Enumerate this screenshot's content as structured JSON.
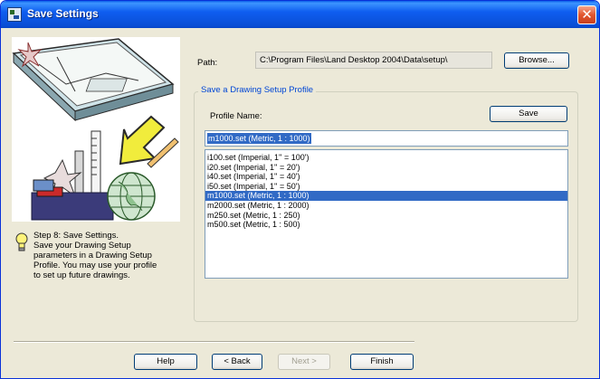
{
  "window": {
    "title": "Save Settings",
    "close_glyph": "✕"
  },
  "left": {
    "illustration_icon": "setup-wizard-illustration",
    "tip_icon": "lightbulb-icon",
    "step_lines": [
      "Step 8:  Save Settings.",
      "Save your Drawing Setup",
      "parameters in a Drawing Setup",
      "Profile.  You may use your profile",
      "to set up future drawings."
    ]
  },
  "path": {
    "label": "Path:",
    "value": "C:\\Program Files\\Land Desktop 2004\\Data\\setup\\",
    "browse_label": "Browse..."
  },
  "group": {
    "legend": "Save a Drawing Setup Profile",
    "profile_label": "Profile Name:",
    "save_label": "Save",
    "profile_value": "m1000.set  (Metric, 1 : 1000)",
    "list_items": [
      "i100.set  (Imperial, 1'' = 100')",
      "i20.set  (Imperial, 1'' = 20')",
      "i40.set  (Imperial, 1'' = 40')",
      "i50.set  (Imperial, 1'' = 50')",
      "m1000.set  (Metric, 1 : 1000)",
      "m2000.set  (Metric, 1 : 2000)",
      "m250.set  (Metric, 1 : 250)",
      "m500.set  (Metric, 1 : 500)"
    ],
    "selected_index": 4
  },
  "buttons": {
    "help": "Help",
    "back": "< Back",
    "next": "Next >",
    "finish": "Finish"
  },
  "colors": {
    "titlebar": "#0a4fd6",
    "selection": "#316ac5",
    "group_legend": "#0046d5",
    "dialog_bg": "#ece9d8"
  }
}
